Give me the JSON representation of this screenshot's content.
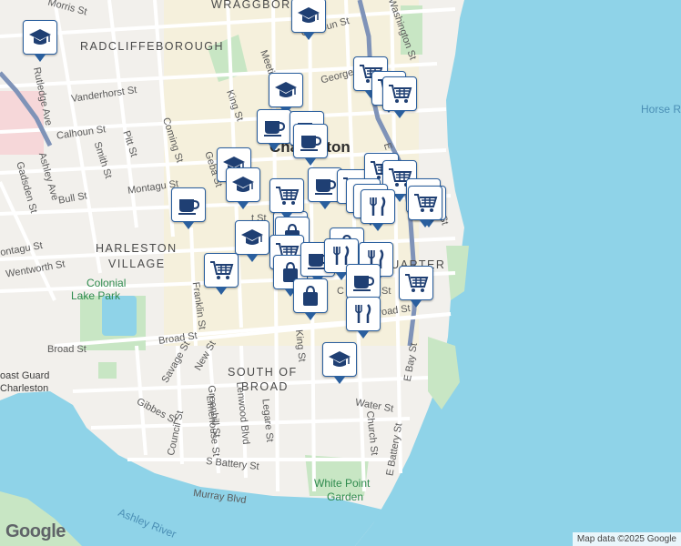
{
  "map": {
    "labels": {
      "wraggborough": "WRAGGBORO",
      "radcliffeborough": "RADCLIFFEBOROUGH",
      "harleston1": "HARLESTON",
      "harleston2": "VILLAGE",
      "south_of_broad1": "SOUTH OF",
      "south_of_broad2": "BROAD",
      "charleston": "Charleston",
      "quarter": "QUARTER",
      "colonial_lake1": "Colonial",
      "colonial_lake2": "Lake Park",
      "white_point1": "White Point",
      "white_point2": "Garden",
      "coast_guard1": "oast Guard",
      "coast_guard2": "Charleston",
      "horse": "Horse R",
      "ashley_river": "Ashley River"
    },
    "streets": {
      "morris": "Morris St",
      "calhoun_top": "Calhoun St",
      "washington": "Washington St",
      "meeting": "Meeting",
      "george": "George",
      "vanderhorst": "Vanderhorst St",
      "rutledge": "Rutledge Ave",
      "king_top": "King St",
      "calhoun_left": "Calhoun St",
      "smith": "Smith St",
      "pitt": "Pitt St",
      "coming": "Coming St",
      "ashley_ave": "Ashley Ave",
      "bull": "Bull St",
      "gadsden": "Gadsden St",
      "montagu": "Montagu St",
      "gerber": "Geba St",
      "ontagu": "ontagu St",
      "wentworth": "Wentworth St",
      "franklin": "Franklin St",
      "broad_left": "Broad St",
      "broad_mid": "Broad St",
      "broad_right": "Broad St",
      "savage": "Savage St",
      "new": "New St",
      "king_mid": "King St",
      "e_bay": "E Bay St",
      "church": "Church St",
      "water": "Water St",
      "gibbes": "Gibbes St",
      "council": "Council St",
      "limehouse": "Limehouse St",
      "greenhill": "Greenhill St",
      "lenwood": "Lenwood Blvd",
      "legare": "Legare St",
      "s_battery": "S Battery St",
      "e_battery": "E Battery St",
      "murray": "Murray Blvd",
      "cst": "C St",
      "st_frag": "St",
      "e_frag": "E",
      "st_right": "St",
      "t_st": "t St"
    },
    "colors": {
      "land": "#f2f0ec",
      "water": "#8fd3e8",
      "park": "#c8e6c4",
      "highway": "#7f93b8",
      "pin_border": "#2a5f9e",
      "pin_icon": "#1f3f73"
    },
    "pins": [
      {
        "type": "school",
        "name": "school-pin"
      },
      {
        "type": "school",
        "name": "school-pin"
      },
      {
        "type": "cart",
        "name": "grocery-pin"
      },
      {
        "type": "cart",
        "name": "grocery-pin"
      },
      {
        "type": "cart",
        "name": "grocery-pin"
      },
      {
        "type": "bag",
        "name": "shopping-pin"
      },
      {
        "type": "school",
        "name": "school-pin"
      },
      {
        "type": "cup",
        "name": "cafe-pin"
      },
      {
        "type": "cup",
        "name": "cafe-pin"
      },
      {
        "type": "cup",
        "name": "cafe-pin"
      },
      {
        "type": "school",
        "name": "school-pin"
      },
      {
        "type": "school",
        "name": "school-pin"
      },
      {
        "type": "cup",
        "name": "cafe-pin"
      },
      {
        "type": "cup",
        "name": "cafe-pin"
      },
      {
        "type": "cart",
        "name": "grocery-pin"
      },
      {
        "type": "cart",
        "name": "grocery-pin"
      },
      {
        "type": "cart",
        "name": "grocery-pin"
      },
      {
        "type": "cup",
        "name": "cafe-pin"
      },
      {
        "type": "cart",
        "name": "grocery-pin"
      },
      {
        "type": "fork",
        "name": "restaurant-pin"
      },
      {
        "type": "fork",
        "name": "restaurant-pin"
      },
      {
        "type": "cart",
        "name": "grocery-pin"
      },
      {
        "type": "cart",
        "name": "grocery-pin"
      },
      {
        "type": "cart",
        "name": "grocery-pin"
      },
      {
        "type": "school",
        "name": "school-pin"
      },
      {
        "type": "bag",
        "name": "shopping-pin"
      },
      {
        "type": "cart",
        "name": "grocery-pin"
      },
      {
        "type": "cart",
        "name": "grocery-pin"
      },
      {
        "type": "bag",
        "name": "shopping-pin"
      },
      {
        "type": "cup",
        "name": "cafe-pin"
      },
      {
        "type": "bag",
        "name": "shopping-pin"
      },
      {
        "type": "fork",
        "name": "restaurant-pin"
      },
      {
        "type": "fork",
        "name": "restaurant-pin"
      },
      {
        "type": "cart",
        "name": "grocery-pin"
      },
      {
        "type": "cup",
        "name": "cafe-pin"
      },
      {
        "type": "fork",
        "name": "restaurant-pin"
      },
      {
        "type": "bag",
        "name": "shopping-pin"
      },
      {
        "type": "school",
        "name": "school-pin"
      }
    ]
  },
  "footer": {
    "logo": "Google",
    "attribution": "Map data ©2025 Google"
  }
}
